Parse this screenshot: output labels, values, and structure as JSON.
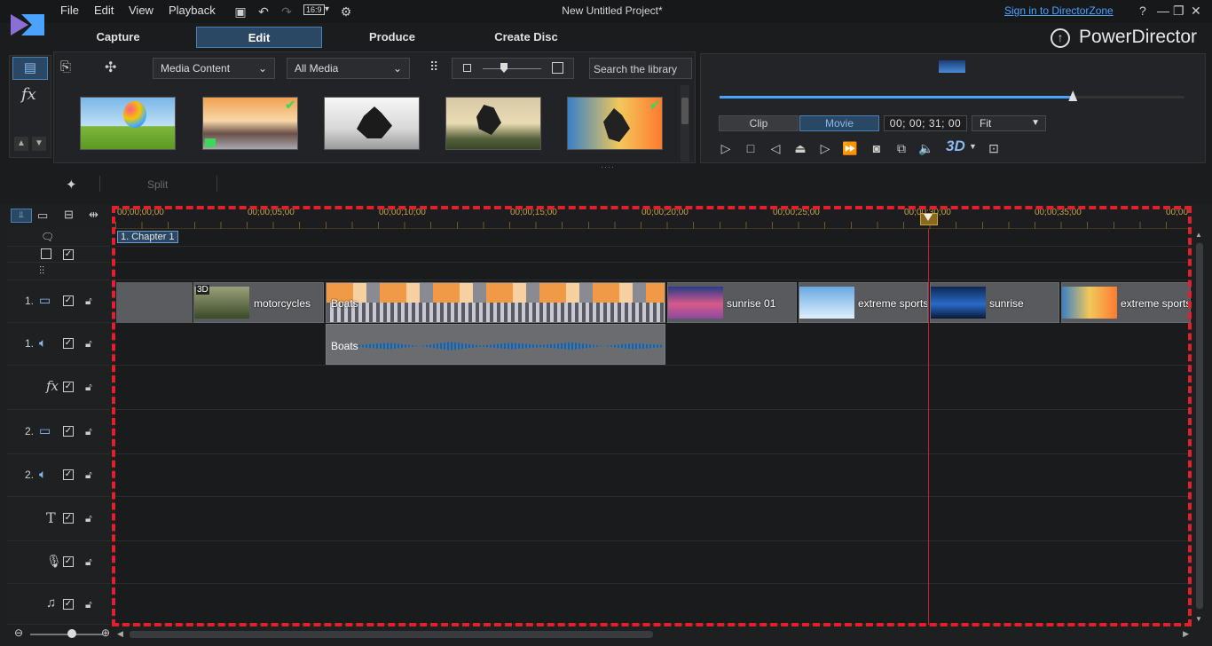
{
  "menu": {
    "file": "File",
    "edit": "Edit",
    "view": "View",
    "playback": "Playback",
    "aspect": "16:9",
    "aspect_caret": "▾",
    "window_title": "New Untitled Project*",
    "directorzone_link": "Sign in to DirectorZone",
    "help": "?"
  },
  "mode_tabs": {
    "capture": "Capture",
    "edit": "Edit",
    "produce": "Produce",
    "create_disc": "Create Disc"
  },
  "brand": {
    "name": "PowerDirector"
  },
  "left_rail": {
    "fx_label": "fx"
  },
  "library": {
    "media_content": "Media Content",
    "all_media": "All Media",
    "search_placeholder": "Search the library"
  },
  "preview": {
    "clip_label": "Clip",
    "movie_label": "Movie",
    "timecode": "00; 00; 31; 00",
    "fit_label": "Fit",
    "badge_3d": "3D",
    "scrub_fraction": 0.76
  },
  "toolbar": {
    "split_label": "Split"
  },
  "timeline": {
    "ruler_labels": [
      "00;00;00;00",
      "00;00;05;00",
      "00;00;10;00",
      "00;00;15;00",
      "00;00;20;00",
      "00;00;25;00",
      "00;00;30;00",
      "00;00;35;00",
      "00;00"
    ],
    "chapter_label": "1. Chapter 1",
    "tracks": {
      "video1_num": "1.",
      "audio1_num": "1.",
      "video2_num": "2.",
      "audio2_num": "2.",
      "fx_label": "fx",
      "title_label": "T"
    },
    "clips": {
      "motorcycles": "motorcycles",
      "motorcycles_badge": "3D",
      "boats": "Boats",
      "sunrise01": "sunrise 01",
      "extreme1": "extreme sports",
      "sunrise": "sunrise",
      "extreme2": "extreme sports",
      "boats_audio": "Boats"
    }
  },
  "colors": {
    "accent": "#4aa3ff",
    "active_tab": "#2a4764",
    "playhead": "#c8202b",
    "highlight_dash": "#e0202a"
  }
}
